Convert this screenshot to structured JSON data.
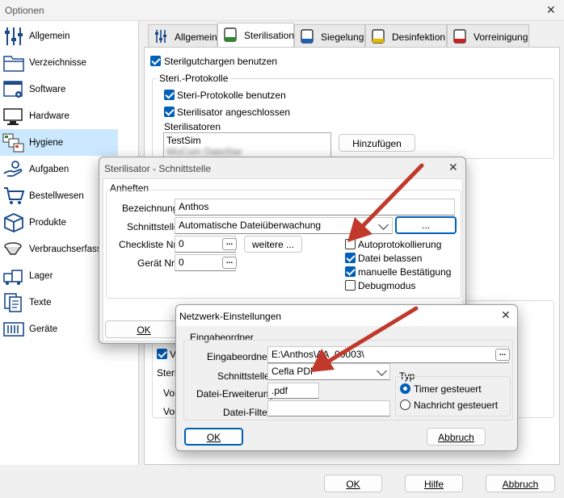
{
  "window": {
    "title": "Optionen"
  },
  "sidebar": {
    "items": [
      {
        "label": "Allgemein",
        "icon": "sliders-icon"
      },
      {
        "label": "Verzeichnisse",
        "icon": "folder-icon"
      },
      {
        "label": "Software",
        "icon": "software-gear-icon"
      },
      {
        "label": "Hardware",
        "icon": "monitor-icon"
      },
      {
        "label": "Hygiene",
        "icon": "hygiene-icon"
      },
      {
        "label": "Aufgaben",
        "icon": "hand-task-icon"
      },
      {
        "label": "Bestellwesen",
        "icon": "cart-icon"
      },
      {
        "label": "Produkte",
        "icon": "box-icon"
      },
      {
        "label": "Verbrauchserfassung",
        "icon": "consumption-icon"
      },
      {
        "label": "Lager",
        "icon": "warehouse-icon"
      },
      {
        "label": "Texte",
        "icon": "documents-icon"
      },
      {
        "label": "Geräte",
        "icon": "devices-icon"
      }
    ]
  },
  "tabs": [
    {
      "label": "Allgemein"
    },
    {
      "label": "Sterilisation"
    },
    {
      "label": "Siegelung"
    },
    {
      "label": "Desinfektion"
    },
    {
      "label": "Vorreinigung"
    }
  ],
  "sterilisation": {
    "use_batches": "Sterilgutchargen benutzen",
    "protocols_group": "Steri.-Protokolle",
    "use_protocols": "Steri-Protokolle benutzen",
    "connected": "Sterilisator angeschlossen",
    "sterilizers_label": "Sterilisatoren",
    "sterilizers": [
      "TestSim",
      "WuCom DataStar"
    ],
    "add_button": "Hinzufügen",
    "lower_group": "Sterili",
    "row1": "Vor",
    "row2": "Vor",
    "check_v": "V"
  },
  "footer": {
    "ok": "OK",
    "help": "Hilfe",
    "cancel": "Abbruch"
  },
  "interface_dialog": {
    "title": "Sterilisator - Schnittstelle",
    "group": "Anheften",
    "name_label": "Bezeichnung",
    "name_value": "Anthos",
    "interface_label": "Schnittstelle",
    "interface_value": "Automatische Dateiüberwachung",
    "dots_button": "...",
    "checklist_label": "Checkliste Nr.",
    "checklist_value": "0",
    "more_button": "weitere ...",
    "device_label": "Gerät Nr.",
    "device_value": "0",
    "auto_log": "Autoprotokollierung",
    "keep_file": "Datei belassen",
    "manual_confirm": "manuelle Bestätigung",
    "debug": "Debugmodus",
    "ok": "OK"
  },
  "network_dialog": {
    "title": "Netzwerk-Einstellungen",
    "group": "Eingabeordner",
    "folder_label": "Eingabeordner",
    "folder_value": "E:\\Anthos\\AA_00003\\",
    "interface_label": "Schnittstelle",
    "interface_value": "Cefla PDF",
    "ext_label": "Datei-Erweiterung",
    "ext_value": ".pdf",
    "filter_label": "Datei-Filter",
    "filter_value": "",
    "type_group": "Typ",
    "timer": "Timer gesteuert",
    "message": "Nachricht gesteuert",
    "ok": "OK",
    "cancel": "Abbruch"
  },
  "colors": {
    "accent": "#005fb8",
    "arrow": "#c0392b",
    "selection": "#cce8ff"
  }
}
